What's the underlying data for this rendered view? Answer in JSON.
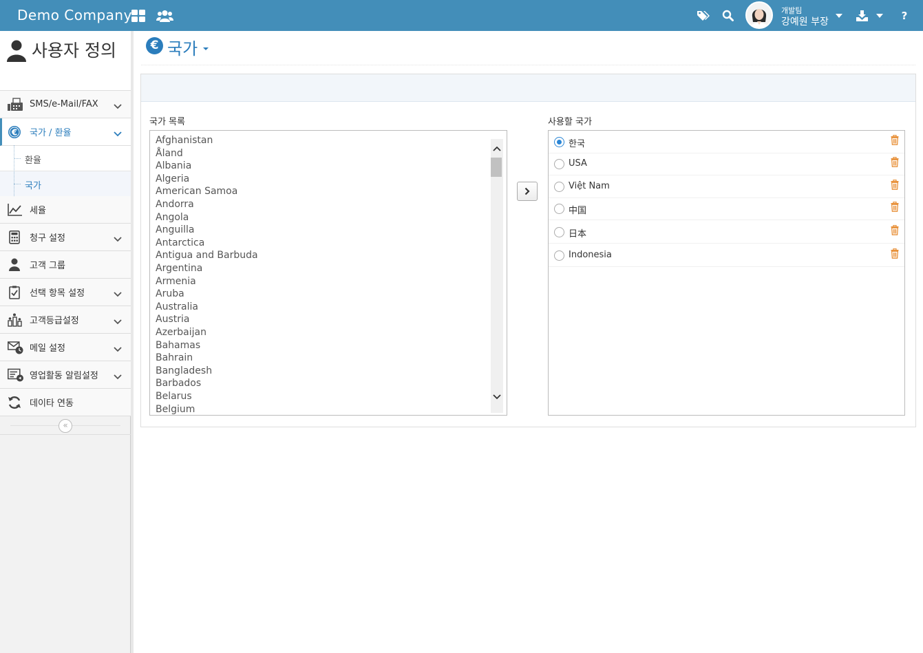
{
  "header": {
    "brand": "Demo Company",
    "user_team": "개발팀",
    "user_name": "강예원 부장"
  },
  "sidebar": {
    "title": "사용자 정의",
    "items": [
      {
        "label": "SMS/e-Mail/FAX"
      },
      {
        "label": "국가 / 환율"
      },
      {
        "label": "세율"
      },
      {
        "label": "청구 설정"
      },
      {
        "label": "고객 그룹"
      },
      {
        "label": "선택 항목 설정"
      },
      {
        "label": "고객등급설정"
      },
      {
        "label": "메일 설정"
      },
      {
        "label": "영업활동 알림설정"
      },
      {
        "label": "데이타 연동"
      }
    ],
    "sub_items": [
      {
        "label": "환율"
      },
      {
        "label": "국가"
      }
    ]
  },
  "page": {
    "title": "국가",
    "list_label": "국가 목록",
    "use_label": "사용할 국가"
  },
  "countries": [
    "Afghanistan",
    "Åland",
    "Albania",
    "Algeria",
    "American Samoa",
    "Andorra",
    "Angola",
    "Anguilla",
    "Antarctica",
    "Antigua and Barbuda",
    "Argentina",
    "Armenia",
    "Aruba",
    "Australia",
    "Austria",
    "Azerbaijan",
    "Bahamas",
    "Bahrain",
    "Bangladesh",
    "Barbados",
    "Belarus",
    "Belgium"
  ],
  "used_countries": [
    {
      "name": "한국",
      "selected": true
    },
    {
      "name": "USA",
      "selected": false
    },
    {
      "name": "Việt Nam",
      "selected": false
    },
    {
      "name": "中国",
      "selected": false
    },
    {
      "name": "日本",
      "selected": false
    },
    {
      "name": "Indonesia",
      "selected": false
    }
  ],
  "colors": {
    "topbar": "#438eb9",
    "accent": "#2b7dbc",
    "trash": "#e8913a"
  }
}
